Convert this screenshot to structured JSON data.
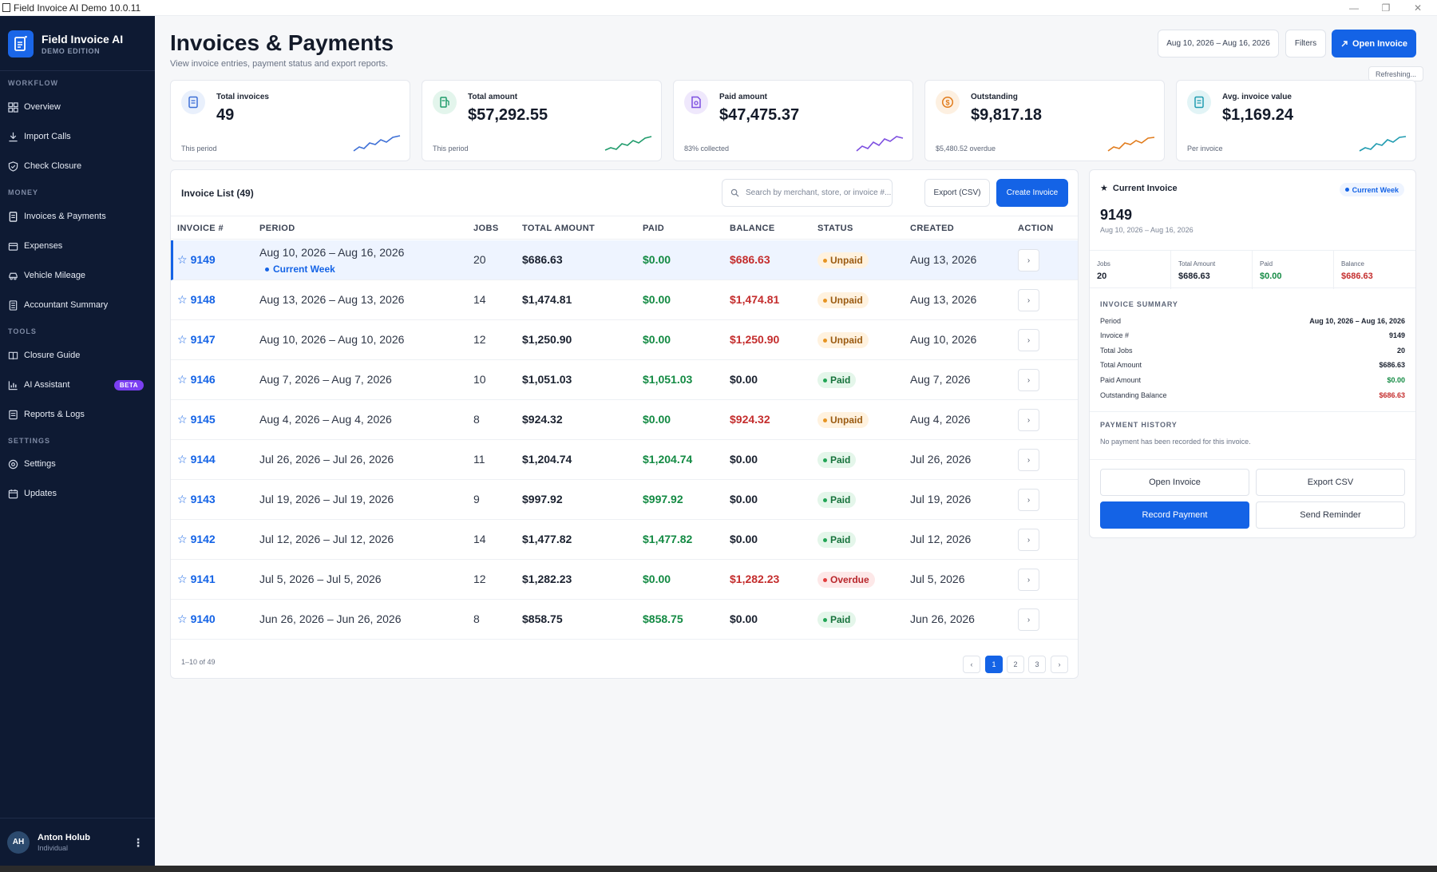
{
  "window": {
    "title": "Field Invoice AI Demo 10.0.11",
    "minimize": "—",
    "restore": "❐",
    "close": "✕"
  },
  "brand": {
    "name": "Field Invoice AI",
    "edition": "DEMO EDITION"
  },
  "sidebar": {
    "sections": [
      {
        "label": "WORKFLOW"
      },
      {
        "label": "MONEY"
      },
      {
        "label": "TOOLS"
      },
      {
        "label": "SETTINGS"
      }
    ],
    "items": [
      {
        "label": "Overview",
        "icon": "grid-icon"
      },
      {
        "label": "Import Calls",
        "icon": "download-icon"
      },
      {
        "label": "Check Closure",
        "icon": "shield-icon"
      },
      {
        "label": "Invoices & Payments",
        "icon": "document-icon"
      },
      {
        "label": "Expenses",
        "icon": "wallet-icon"
      },
      {
        "label": "Vehicle Mileage",
        "icon": "car-icon"
      },
      {
        "label": "Accountant Summary",
        "icon": "calculator-icon"
      },
      {
        "label": "Closure Guide",
        "icon": "book-icon"
      },
      {
        "label": "AI Assistant",
        "icon": "chart-icon",
        "badge": "BETA"
      },
      {
        "label": "Reports & Logs",
        "icon": "report-icon"
      },
      {
        "label": "Settings",
        "icon": "gear-icon"
      },
      {
        "label": "Updates",
        "icon": "calendar-icon"
      }
    ],
    "user": {
      "initials": "AH",
      "name": "Anton Holub",
      "role": "Individual",
      "menu": "⋮"
    }
  },
  "header": {
    "title": "Invoices & Payments",
    "subtitle": "View invoice entries, payment status and export reports.",
    "date_range": "Aug 10, 2026 – Aug 16, 2026",
    "filters": "Filters",
    "open_invoice": "Open Invoice",
    "refreshing": "Refreshing..."
  },
  "stats": [
    {
      "label": "Total invoices",
      "value": "49",
      "note": "This period",
      "color": "#3d6fd6",
      "bg": "#e9f0fc",
      "icon": "invoice-icon"
    },
    {
      "label": "Total amount",
      "value": "$57,292.55",
      "note": "This period",
      "color": "#1f9b6b",
      "bg": "#e3f5ec",
      "icon": "fuel-icon"
    },
    {
      "label": "Paid amount",
      "value": "$47,475.37",
      "note": "83% collected",
      "color": "#7d4fe0",
      "bg": "#efe8fc",
      "icon": "receipt-icon"
    },
    {
      "label": "Outstanding",
      "value": "$9,817.18",
      "note": "$5,480.52 overdue",
      "color": "#e17c1d",
      "bg": "#fdf0e1",
      "icon": "dollar-icon"
    },
    {
      "label": "Avg. invoice value",
      "value": "$1,169.24",
      "note": "Per invoice",
      "color": "#1f9bb0",
      "bg": "#e2f4f6",
      "icon": "invoice-icon"
    }
  ],
  "list": {
    "title": "Invoice List (49)",
    "search_placeholder": "Search by merchant, store, or invoice #...",
    "export_csv": "Export (CSV)",
    "create_invoice": "Create Invoice",
    "columns": [
      "INVOICE #",
      "PERIOD",
      "JOBS",
      "TOTAL AMOUNT",
      "PAID",
      "BALANCE",
      "STATUS",
      "CREATED",
      "ACTION"
    ],
    "rows": [
      {
        "invoice": "9149",
        "period": "Aug 10, 2026 – Aug 16, 2026",
        "tag": "Current Week",
        "jobs": "20",
        "total": "$686.63",
        "paid": "$0.00",
        "balance": "$686.63",
        "status": "Unpaid",
        "created": "Aug 13, 2026"
      },
      {
        "invoice": "9148",
        "period": "Aug 13, 2026 – Aug 13, 2026",
        "jobs": "14",
        "total": "$1,474.81",
        "paid": "$0.00",
        "balance": "$1,474.81",
        "status": "Unpaid",
        "created": "Aug 13, 2026"
      },
      {
        "invoice": "9147",
        "period": "Aug 10, 2026 – Aug 10, 2026",
        "jobs": "12",
        "total": "$1,250.90",
        "paid": "$0.00",
        "balance": "$1,250.90",
        "status": "Unpaid",
        "created": "Aug 10, 2026"
      },
      {
        "invoice": "9146",
        "period": "Aug 7, 2026 – Aug 7, 2026",
        "jobs": "10",
        "total": "$1,051.03",
        "paid": "$1,051.03",
        "balance": "$0.00",
        "status": "Paid",
        "created": "Aug 7, 2026"
      },
      {
        "invoice": "9145",
        "period": "Aug 4, 2026 – Aug 4, 2026",
        "jobs": "8",
        "total": "$924.32",
        "paid": "$0.00",
        "balance": "$924.32",
        "status": "Unpaid",
        "created": "Aug 4, 2026"
      },
      {
        "invoice": "9144",
        "period": "Jul 26, 2026 – Jul 26, 2026",
        "jobs": "11",
        "total": "$1,204.74",
        "paid": "$1,204.74",
        "balance": "$0.00",
        "status": "Paid",
        "created": "Jul 26, 2026"
      },
      {
        "invoice": "9143",
        "period": "Jul 19, 2026 – Jul 19, 2026",
        "jobs": "9",
        "total": "$997.92",
        "paid": "$997.92",
        "balance": "$0.00",
        "status": "Paid",
        "created": "Jul 19, 2026"
      },
      {
        "invoice": "9142",
        "period": "Jul 12, 2026 – Jul 12, 2026",
        "jobs": "14",
        "total": "$1,477.82",
        "paid": "$1,477.82",
        "balance": "$0.00",
        "status": "Paid",
        "created": "Jul 12, 2026"
      },
      {
        "invoice": "9141",
        "period": "Jul 5, 2026 – Jul 5, 2026",
        "jobs": "12",
        "total": "$1,282.23",
        "paid": "$0.00",
        "balance": "$1,282.23",
        "status": "Overdue",
        "created": "Jul 5, 2026"
      },
      {
        "invoice": "9140",
        "period": "Jun 26, 2026 – Jun 26, 2026",
        "jobs": "8",
        "total": "$858.75",
        "paid": "$858.75",
        "balance": "$0.00",
        "status": "Paid",
        "created": "Jun 26, 2026"
      }
    ],
    "action_glyph": "›",
    "footer": "1–10 of 49",
    "pagination": {
      "prev": "‹",
      "pages": [
        "1",
        "2",
        "3"
      ],
      "next": "›",
      "current": "1"
    }
  },
  "detail": {
    "heading": "Current Invoice",
    "week_badge": "Current Week",
    "number": "9149",
    "period": "Aug 10, 2026 – Aug 16, 2026",
    "metrics": [
      {
        "label": "Jobs",
        "value": "20"
      },
      {
        "label": "Total Amount",
        "value": "$686.63"
      },
      {
        "label": "Paid",
        "value": "$0.00"
      },
      {
        "label": "Balance",
        "value": "$686.63"
      }
    ],
    "summary_title": "INVOICE SUMMARY",
    "summary": [
      {
        "k": "Period",
        "v": "Aug 10, 2026 – Aug 16, 2026"
      },
      {
        "k": "Invoice #",
        "v": "9149"
      },
      {
        "k": "Total Jobs",
        "v": "20"
      },
      {
        "k": "Total Amount",
        "v": "$686.63"
      },
      {
        "k": "Paid Amount",
        "v": "$0.00"
      },
      {
        "k": "Outstanding Balance",
        "v": "$686.63"
      }
    ],
    "history_title": "PAYMENT HISTORY",
    "history_note": "No payment has been recorded for this invoice.",
    "buttons": {
      "open": "Open Invoice",
      "export": "Export CSV",
      "record": "Record Payment",
      "remind": "Send Reminder"
    }
  }
}
